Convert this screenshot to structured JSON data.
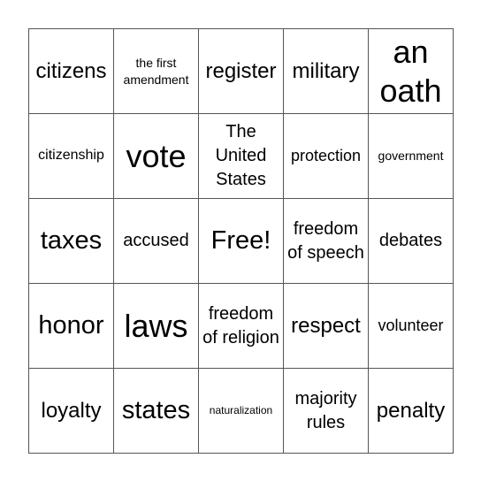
{
  "board": {
    "cells": [
      "citizens",
      "the first amendment",
      "register",
      "military",
      "an oath",
      "citizenship",
      "vote",
      "The United States",
      "protection",
      "government",
      "taxes",
      "accused",
      "Free!",
      "freedom of speech",
      "debates",
      "honor",
      "laws",
      "freedom of religion",
      "respect",
      "volunteer",
      "loyalty",
      "states",
      "naturalization",
      "majority rules",
      "penalty"
    ]
  }
}
